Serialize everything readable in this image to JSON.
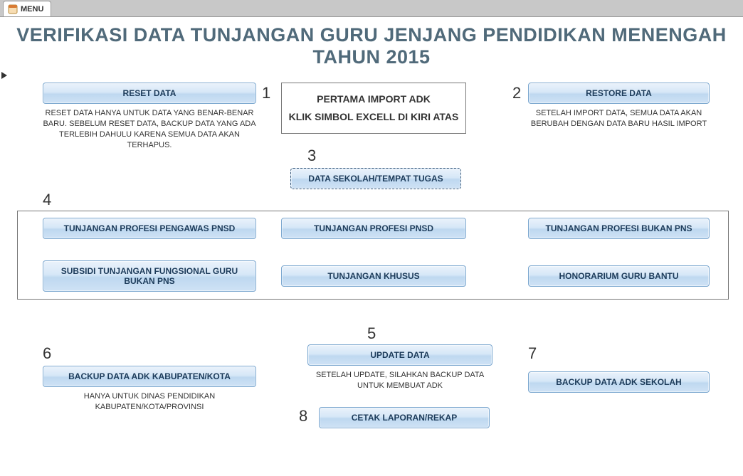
{
  "tab": {
    "label": "MENU"
  },
  "title": {
    "line1": "VERIFIKASI DATA TUNJANGAN GURU JENJANG PENDIDIKAN MENENGAH",
    "line2": "TAHUN 2015"
  },
  "steps": {
    "n1": "1",
    "n2": "2",
    "n3": "3",
    "n4": "4",
    "n5": "5",
    "n6": "6",
    "n7": "7",
    "n8": "8"
  },
  "info": {
    "line1": "PERTAMA IMPORT ADK",
    "line2": "KLIK SIMBOL EXCELL DI KIRI ATAS"
  },
  "reset": {
    "label": "RESET DATA",
    "desc": "RESET DATA HANYA UNTUK DATA YANG BENAR-BENAR BARU. SEBELUM RESET DATA, BACKUP DATA YANG ADA TERLEBIH DAHULU KARENA SEMUA DATA AKAN TERHAPUS."
  },
  "restore": {
    "label": "RESTORE DATA",
    "desc": "SETELAH IMPORT DATA, SEMUA DATA AKAN BERUBAH DENGAN DATA BARU HASIL IMPORT"
  },
  "dataSekolah": {
    "label": "DATA SEKOLAH/TEMPAT TUGAS"
  },
  "grid": {
    "a": "TUNJANGAN PROFESI PENGAWAS PNSD",
    "b": "TUNJANGAN PROFESI PNSD",
    "c": "TUNJANGAN PROFESI BUKAN PNS",
    "d": "SUBSIDI TUNJANGAN FUNGSIONAL GURU BUKAN PNS",
    "e": "TUNJANGAN KHUSUS",
    "f": "HONORARIUM GURU BANTU"
  },
  "update": {
    "label": "UPDATE DATA",
    "desc": "SETELAH UPDATE, SILAHKAN BACKUP DATA UNTUK MEMBUAT ADK"
  },
  "backupKab": {
    "label": "BACKUP DATA ADK KABUPATEN/KOTA",
    "desc": "HANYA UNTUK DINAS PENDIDIKAN KABUPATEN/KOTA/PROVINSI"
  },
  "backupSekolah": {
    "label": "BACKUP DATA ADK SEKOLAH"
  },
  "cetak": {
    "label": "CETAK LAPORAN/REKAP"
  }
}
